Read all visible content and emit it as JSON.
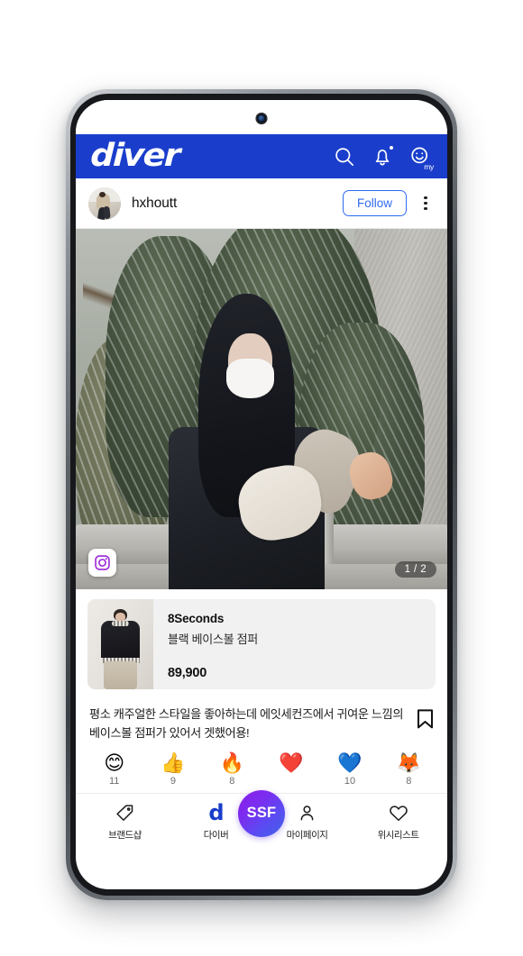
{
  "header": {
    "brand": "diver",
    "icons": [
      {
        "name": "search-icon",
        "label": "search"
      },
      {
        "name": "bell-icon",
        "label": "notifications"
      },
      {
        "name": "my-smiley-icon",
        "label": "my"
      }
    ],
    "my_label": "my",
    "background_color": "#1a3ecb"
  },
  "post": {
    "username": "hxhoutt",
    "follow_label": "Follow",
    "follow_color": "#2f6bef",
    "page_indicator": "1 / 2",
    "source_badge": "instagram-icon",
    "caption": "평소 캐주얼한 스타일을 좋아하는데 에잇세컨즈에서 귀여운 느낌의 베이스볼 점퍼가 있어서 겟했어용!"
  },
  "product": {
    "brand": "8Seconds",
    "name": "블랙 베이스볼 점퍼",
    "price": "89,900"
  },
  "reactions": [
    {
      "emoji": "😊",
      "count": "11",
      "name": "smile"
    },
    {
      "emoji": "👍",
      "count": "9",
      "name": "thumbs-up"
    },
    {
      "emoji": "🔥",
      "count": "8",
      "name": "fire"
    },
    {
      "emoji": "❤️",
      "count": "",
      "name": "red-heart"
    },
    {
      "emoji": "💙",
      "count": "10",
      "name": "blue-heart"
    },
    {
      "emoji": "🦊",
      "count": "8",
      "name": "fox"
    }
  ],
  "bottom_nav": {
    "items": [
      {
        "label": "브랜드샵",
        "icon": "tag-icon"
      },
      {
        "label": "다이버",
        "icon": "diver-d-icon"
      },
      {
        "label": "마이페이지",
        "icon": "person-icon"
      },
      {
        "label": "위시리스트",
        "icon": "heart-icon"
      }
    ],
    "center_button": "SSF",
    "active_index": 1,
    "active_color": "#1a3ecb"
  }
}
